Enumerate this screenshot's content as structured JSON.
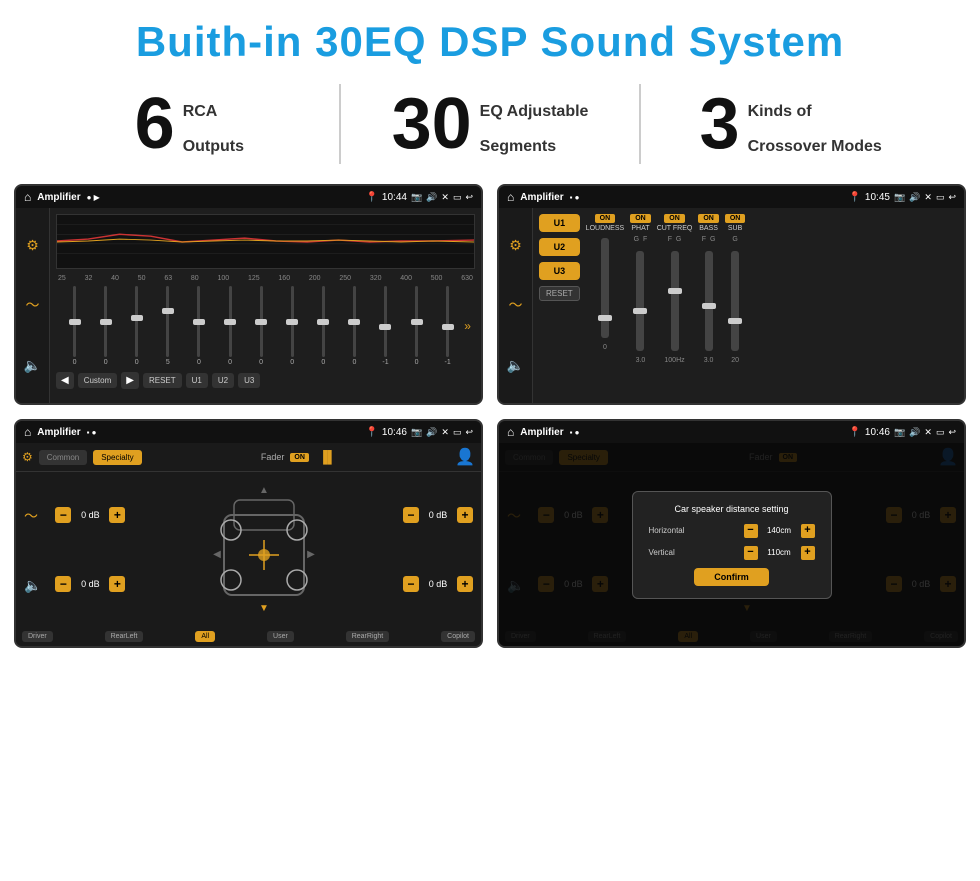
{
  "header": {
    "title": "Buith-in 30EQ DSP Sound System"
  },
  "stats": [
    {
      "number": "6",
      "text_line1": "RCA",
      "text_line2": "Outputs"
    },
    {
      "number": "30",
      "text_line1": "EQ Adjustable",
      "text_line2": "Segments"
    },
    {
      "number": "3",
      "text_line1": "Kinds of",
      "text_line2": "Crossover Modes"
    }
  ],
  "screen1": {
    "title": "Amplifier",
    "time": "10:44",
    "eq_freqs": [
      "25",
      "32",
      "40",
      "50",
      "63",
      "80",
      "100",
      "125",
      "160",
      "200",
      "250",
      "320",
      "400",
      "500",
      "630"
    ],
    "eq_values": [
      "0",
      "0",
      "0",
      "5",
      "0",
      "0",
      "0",
      "0",
      "0",
      "0",
      "-1",
      "0",
      "-1"
    ],
    "mode_label": "Custom",
    "buttons": [
      "RESET",
      "U1",
      "U2",
      "U3"
    ]
  },
  "screen2": {
    "title": "Amplifier",
    "time": "10:45",
    "presets": [
      "U1",
      "U2",
      "U3"
    ],
    "channels": [
      {
        "label": "LOUDNESS",
        "on": true,
        "value": "ON"
      },
      {
        "label": "PHAT",
        "on": true,
        "value": "ON"
      },
      {
        "label": "CUT FREQ",
        "on": true,
        "value": "ON"
      },
      {
        "label": "BASS",
        "on": true,
        "value": "ON"
      },
      {
        "label": "SUB",
        "on": true,
        "value": "ON"
      }
    ],
    "reset_label": "RESET"
  },
  "screen3": {
    "title": "Amplifier",
    "time": "10:46",
    "tabs": [
      "Common",
      "Specialty"
    ],
    "active_tab": "Specialty",
    "fader_label": "Fader",
    "fader_on": "ON",
    "vol_rows": [
      {
        "value": "0 dB"
      },
      {
        "value": "0 dB"
      },
      {
        "value": "0 dB"
      },
      {
        "value": "0 dB"
      }
    ],
    "bottom_labels": [
      "Driver",
      "RearLeft",
      "All",
      "User",
      "RearRight",
      "Copilot"
    ]
  },
  "screen4": {
    "title": "Amplifier",
    "time": "10:46",
    "tabs": [
      "Common",
      "Specialty"
    ],
    "active_tab": "Specialty",
    "fader_on": "ON",
    "dialog": {
      "title": "Car speaker distance setting",
      "fields": [
        {
          "label": "Horizontal",
          "value": "140cm"
        },
        {
          "label": "Vertical",
          "value": "110cm"
        }
      ],
      "confirm_label": "Confirm"
    },
    "bottom_labels": [
      "Driver",
      "RearLeft",
      "All",
      "User",
      "RearRight",
      "Copilot"
    ]
  }
}
